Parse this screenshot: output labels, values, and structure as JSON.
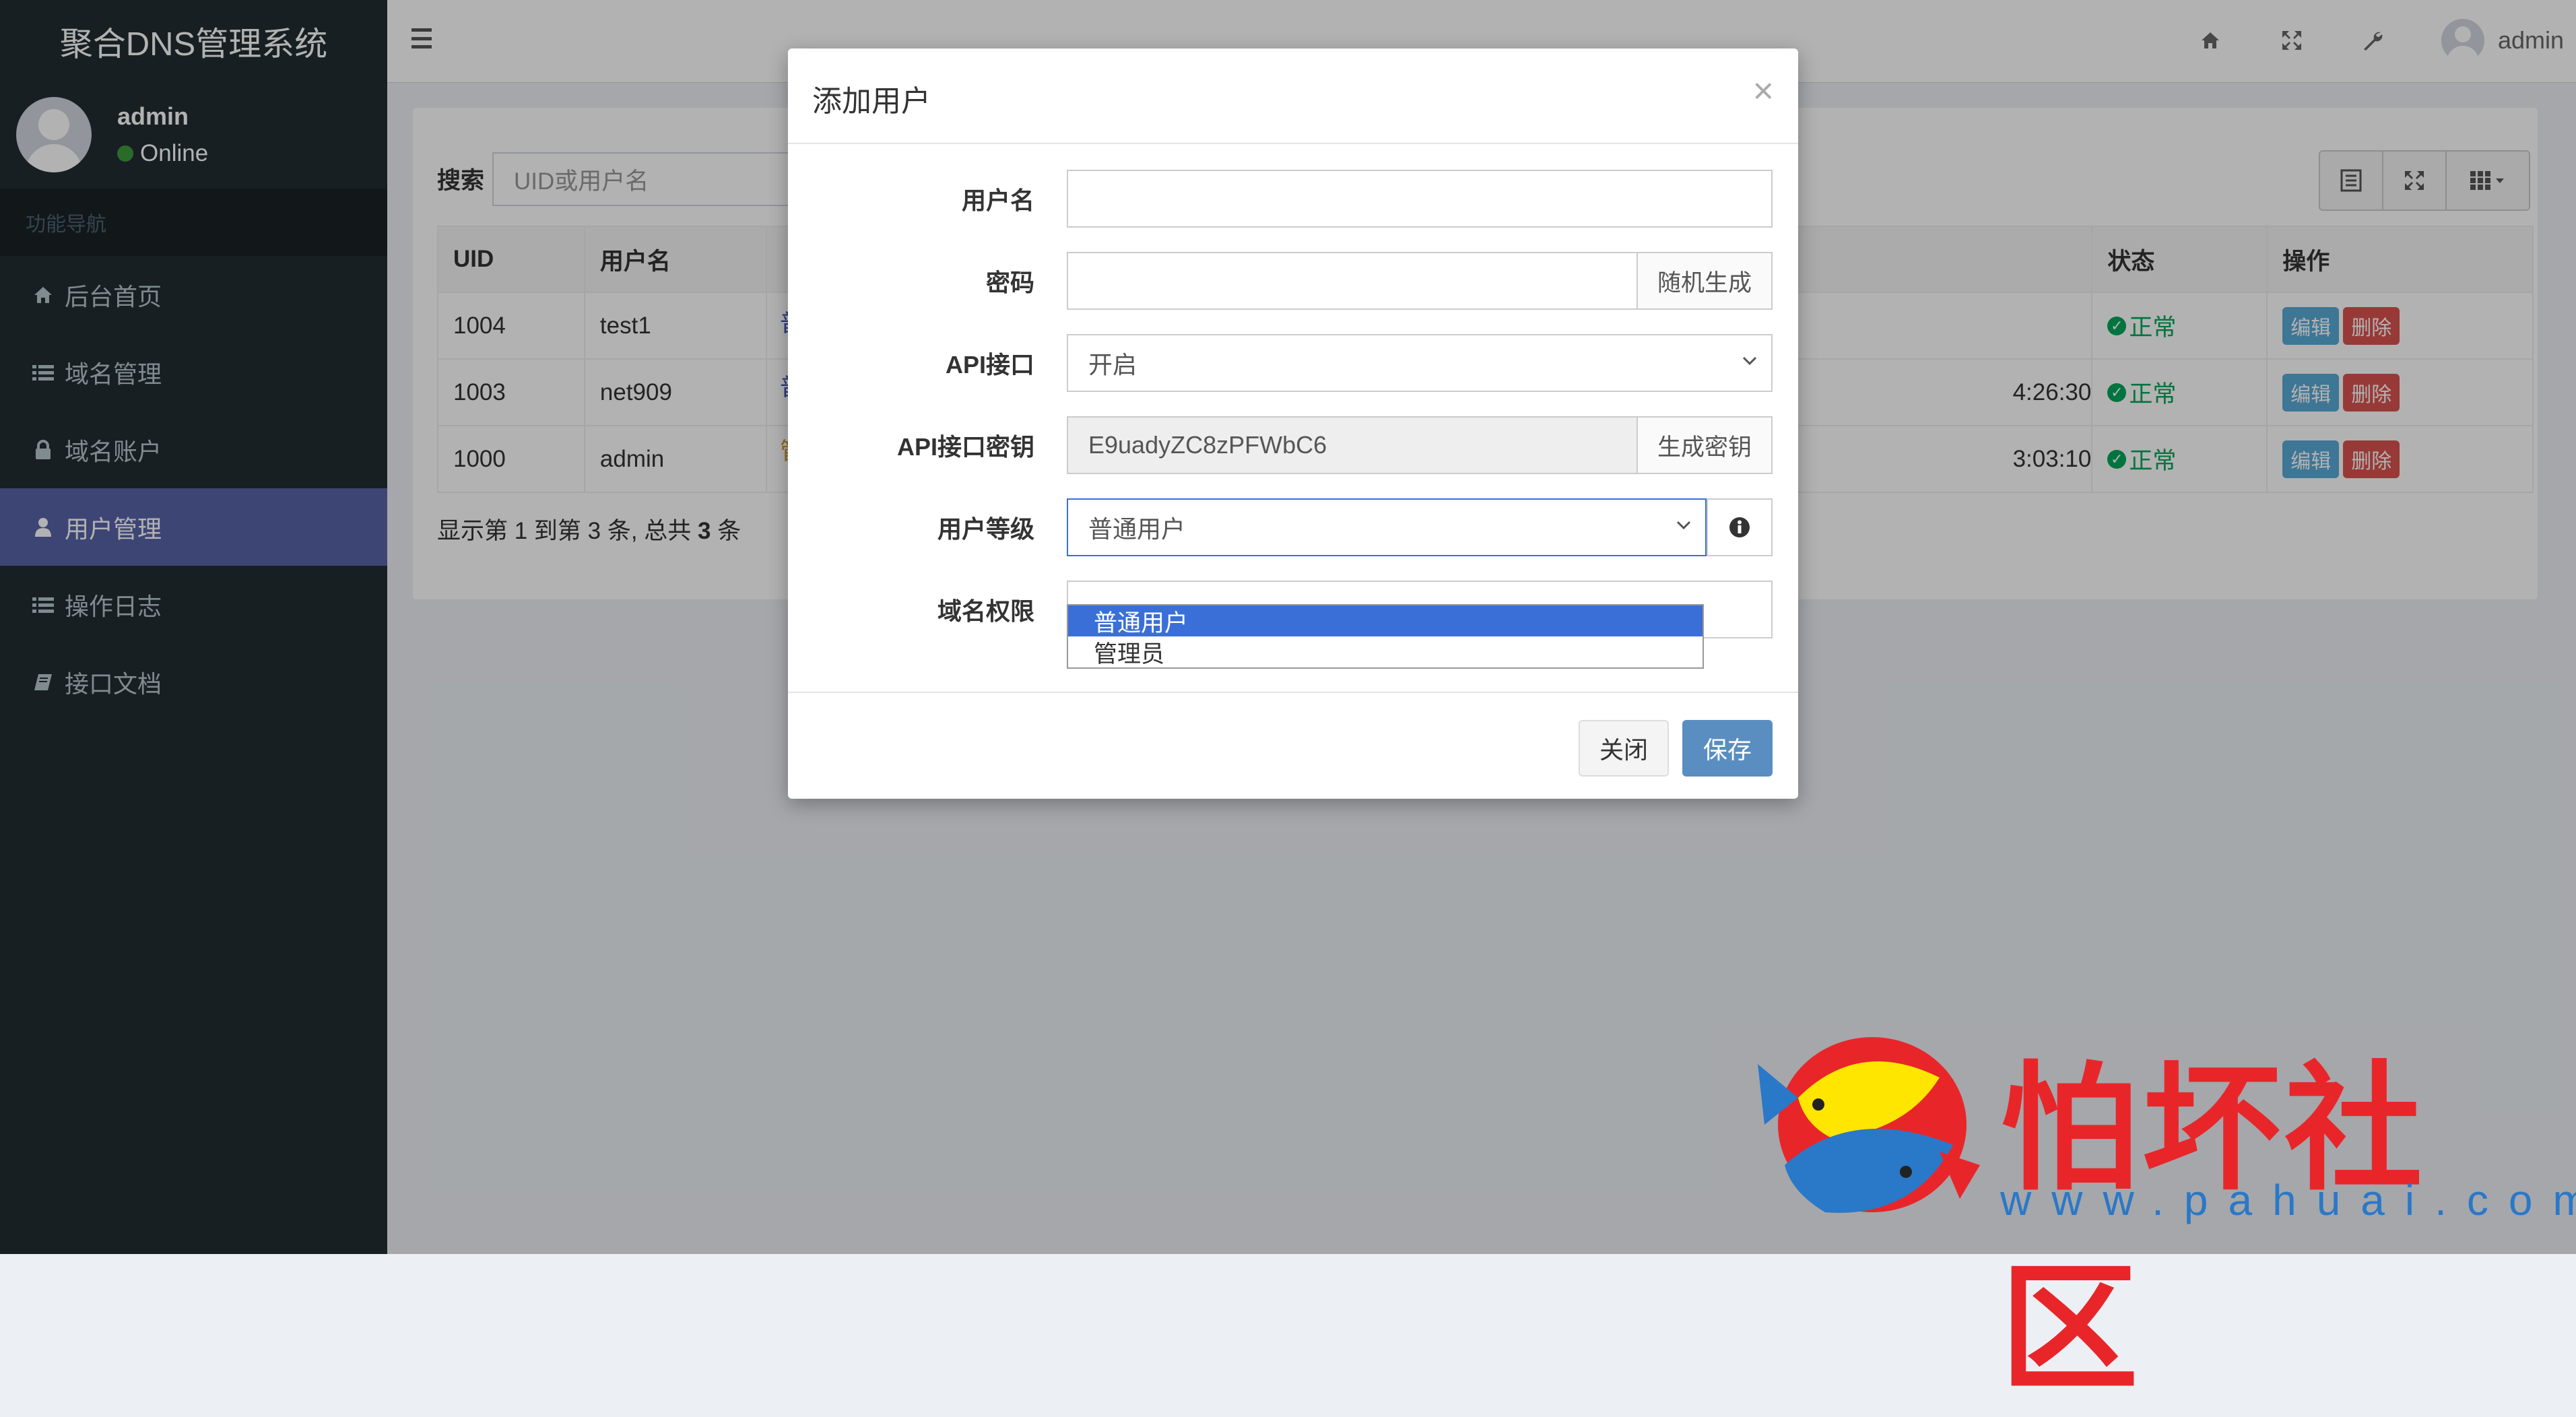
{
  "app": {
    "title": "聚合DNS管理系统"
  },
  "user_panel": {
    "name": "admin",
    "status": "Online"
  },
  "nav": {
    "header": "功能导航",
    "items": [
      {
        "label": "后台首页",
        "icon": "home-icon"
      },
      {
        "label": "域名管理",
        "icon": "list-icon"
      },
      {
        "label": "域名账户",
        "icon": "lock-icon"
      },
      {
        "label": "用户管理",
        "icon": "user-icon",
        "active": true
      },
      {
        "label": "操作日志",
        "icon": "list-icon"
      },
      {
        "label": "接口文档",
        "icon": "book-icon"
      }
    ]
  },
  "topbar": {
    "username": "admin"
  },
  "search": {
    "label": "搜索",
    "placeholder": "UID或用户名"
  },
  "table": {
    "headers": {
      "uid": "UID",
      "username": "用户名",
      "status": "状态",
      "action": "操作"
    },
    "rows": [
      {
        "uid": "1004",
        "username": "test1",
        "partial": "普",
        "time": "",
        "status": "正常"
      },
      {
        "uid": "1003",
        "username": "net909",
        "partial": "普",
        "time": "4:26:30",
        "status": "正常"
      },
      {
        "uid": "1000",
        "username": "admin",
        "partial": "管",
        "time": "3:03:10",
        "status": "正常"
      }
    ],
    "edit_label": "编辑",
    "delete_label": "删除",
    "footer": {
      "prefix": "显示第 1 到第 3 条, 总共 ",
      "total": "3",
      "suffix": " 条"
    }
  },
  "modal": {
    "title": "添加用户",
    "close_symbol": "×",
    "fields": {
      "username": {
        "label": "用户名",
        "value": ""
      },
      "password": {
        "label": "密码",
        "value": "",
        "addon": "随机生成"
      },
      "api": {
        "label": "API接口",
        "value": "开启"
      },
      "api_key": {
        "label": "API接口密钥",
        "value": "E9uadyZC8zPFWbC6",
        "addon": "生成密钥"
      },
      "level": {
        "label": "用户等级",
        "value": "普通用户",
        "options": [
          "普通用户",
          "管理员"
        ]
      },
      "domain_perm": {
        "label": "域名权限",
        "value": ""
      }
    },
    "buttons": {
      "close": "关闭",
      "save": "保存"
    }
  },
  "watermark": {
    "text": "怕坏社区",
    "url": "www.pahuai.com"
  },
  "colors": {
    "sidebar_bg": "#222d32",
    "active_nav": "#5864a8",
    "ok": "#00a65a",
    "edit": "#5aa9d6",
    "delete": "#d9534f",
    "save": "#5b8ec0",
    "option_selected": "#3a6fd8"
  }
}
